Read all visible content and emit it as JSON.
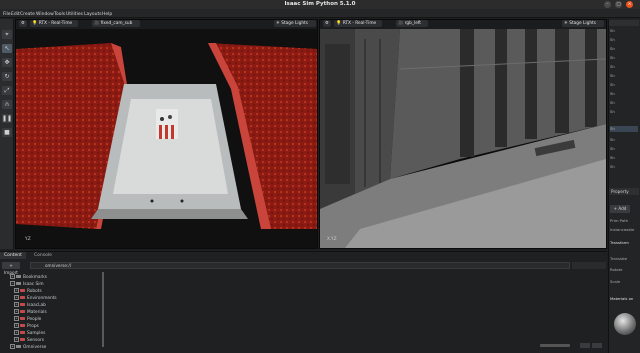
{
  "window": {
    "title": "Isaac Sim Python 5.1.0",
    "minimize": "–",
    "maximize": "□",
    "close": "×"
  },
  "menu": [
    "File",
    "Edit",
    "Create",
    "Window",
    "Tools",
    "Utilities",
    "Layouts",
    "Help"
  ],
  "viewport_left": {
    "renderer": "RTX - Real-Time",
    "camera": "fixed_cam_sub",
    "lights": "Stage Lights",
    "axis_y": "Y",
    "axis_x": "X",
    "grid_label": "Y.Z"
  },
  "viewport_right": {
    "renderer": "RTX - Real-Time",
    "camera": "rgb_left",
    "lights": "Stage Lights",
    "axis": "X.Y.Z"
  },
  "bottom": {
    "tabs": [
      "Content",
      "Console"
    ],
    "import_label": "+ Import",
    "path_value": "omniverse://",
    "tree": [
      {
        "label": "Bookmarks",
        "level": 0
      },
      {
        "label": "Isaac Sim",
        "level": 0
      },
      {
        "label": "Robots",
        "level": 1
      },
      {
        "label": "Environments",
        "level": 1
      },
      {
        "label": "IsaacLab",
        "level": 1
      },
      {
        "label": "Materials",
        "level": 1
      },
      {
        "label": "People",
        "level": 1
      },
      {
        "label": "Props",
        "level": 1
      },
      {
        "label": "Samples",
        "level": 1
      },
      {
        "label": "Sensors",
        "level": 1
      },
      {
        "label": "Omniverse",
        "level": 0
      }
    ]
  },
  "right_panel": {
    "stage_rows": [
      "Sh",
      "Sh",
      "Sh",
      "Sh",
      "Sh",
      "Sh",
      "Sh",
      "Sh",
      "Sh",
      "Sh",
      "Sh",
      "Sh",
      "Sh",
      "Sh",
      "Sh"
    ],
    "property_tab": "Property",
    "add_button": "+ Add",
    "prim_path": "Prim Path",
    "instanceable": "Instanceable",
    "transform": "Transform",
    "translate": "Translate",
    "rotate": "Rotate",
    "scale": "Scale",
    "material": "Materials on"
  }
}
